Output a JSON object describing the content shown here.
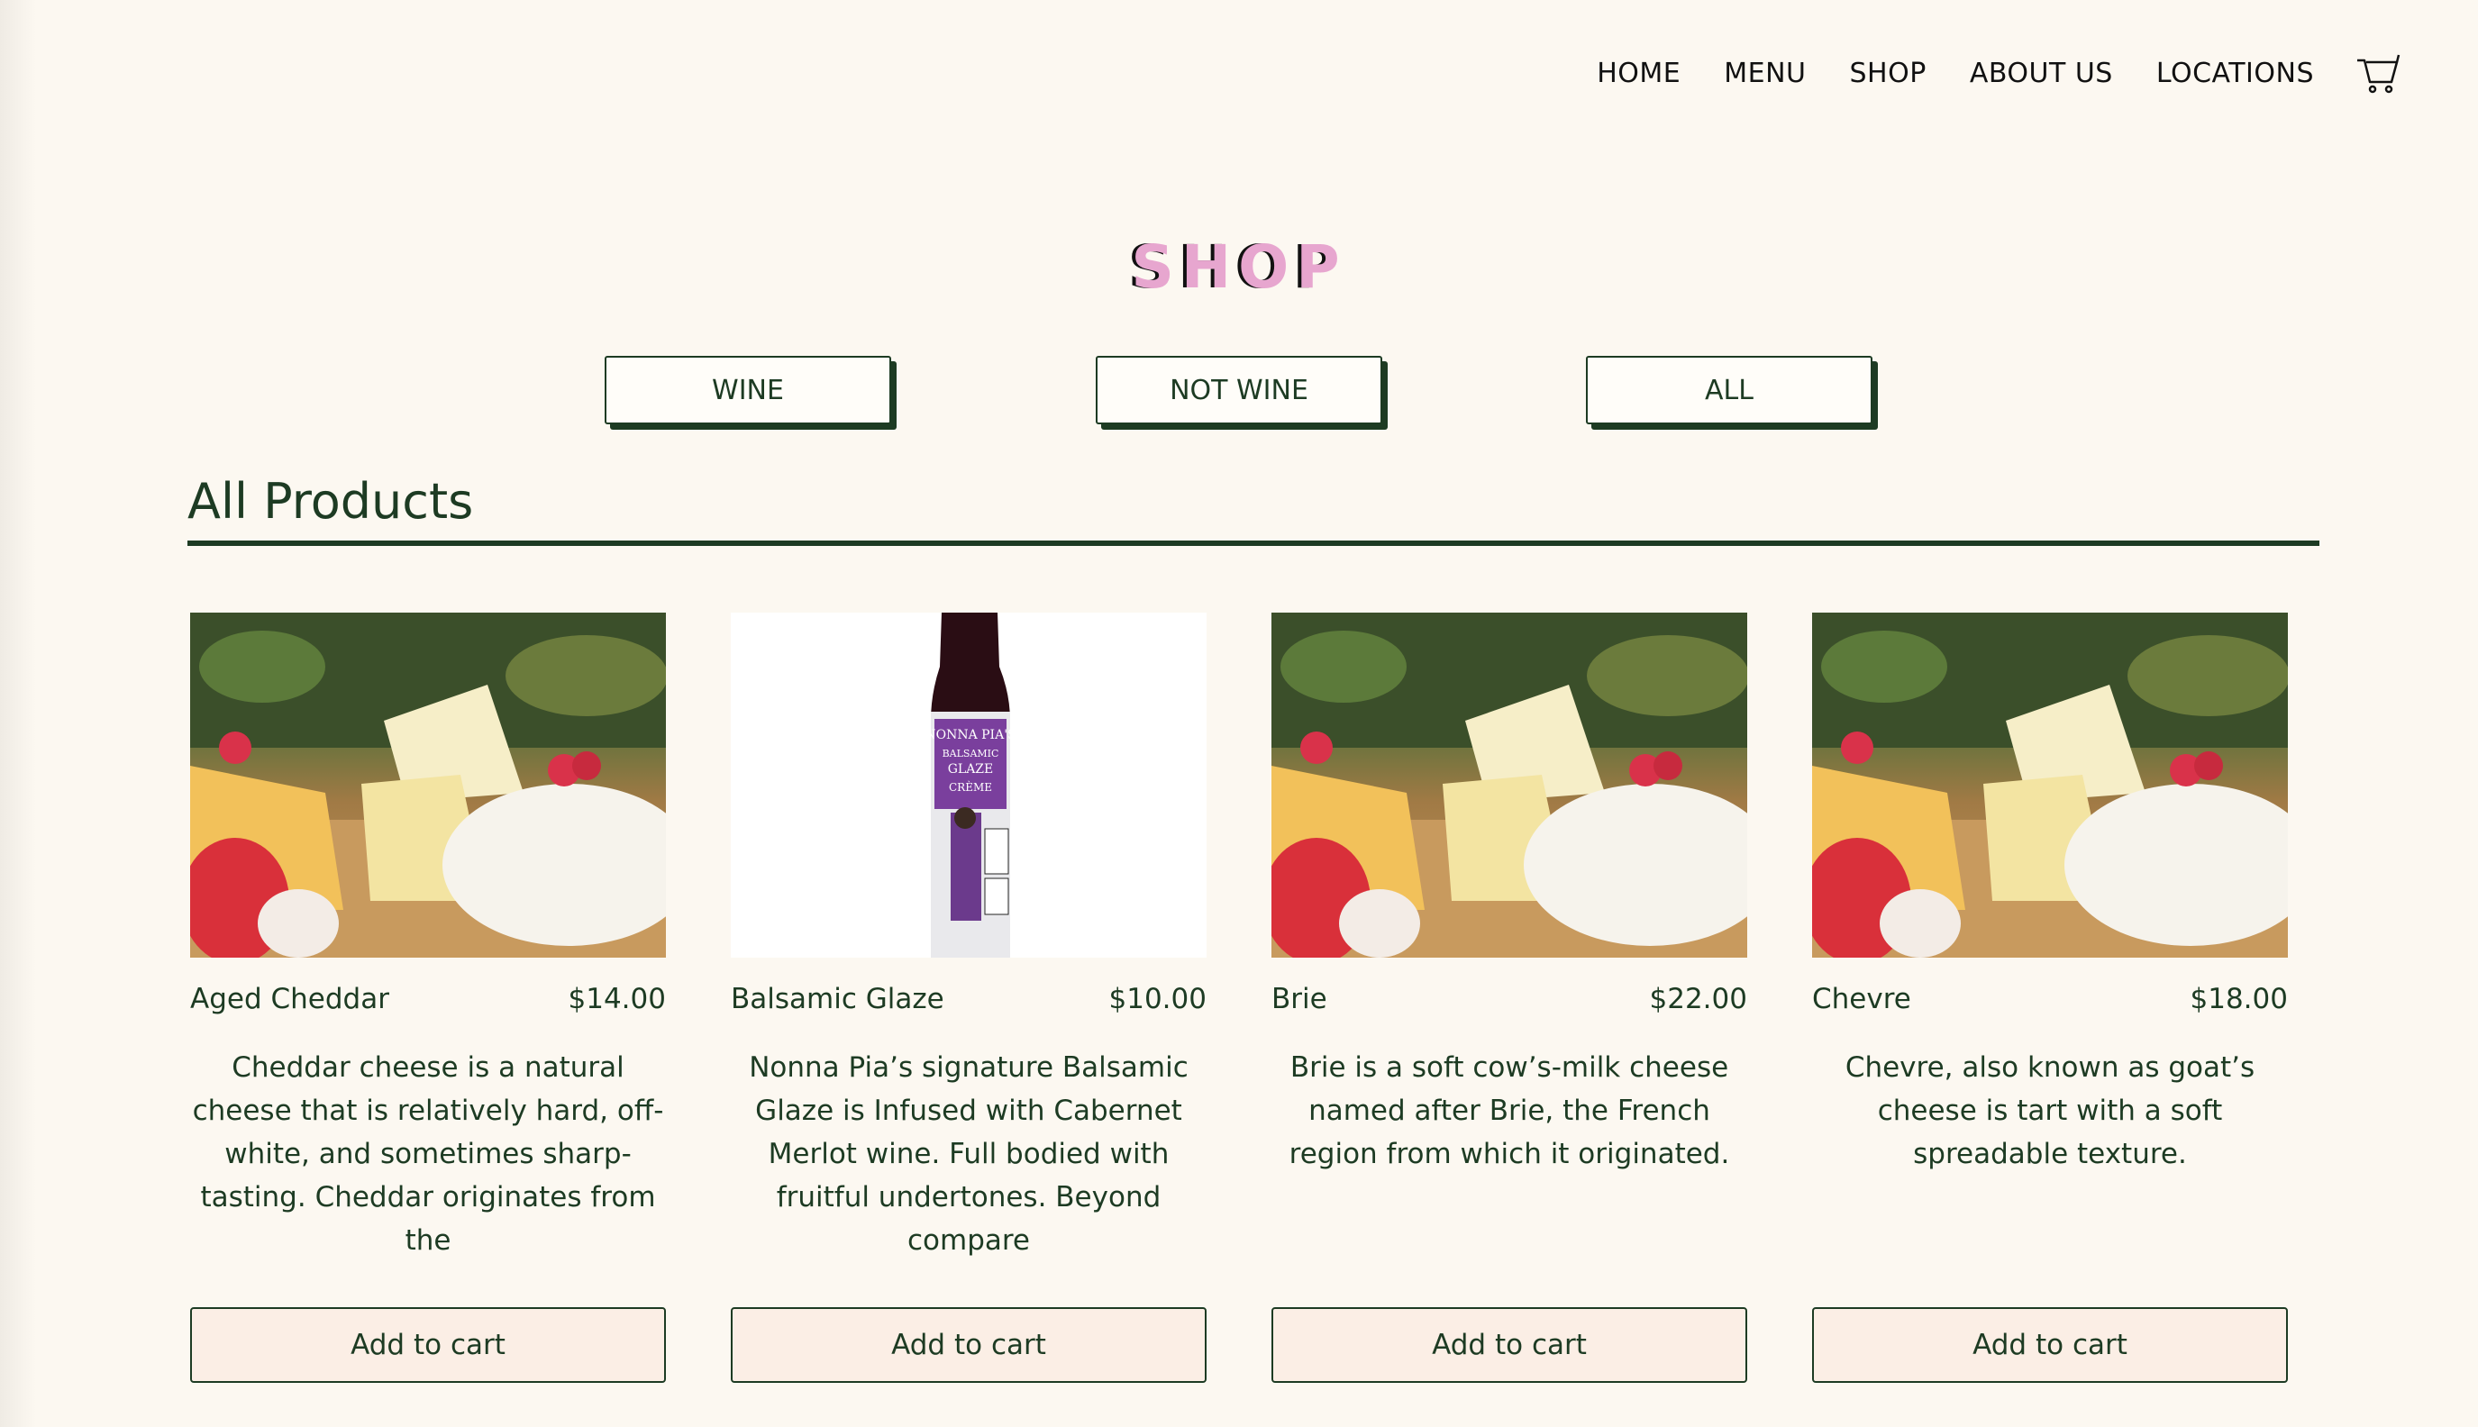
{
  "nav": {
    "items": [
      "HOME",
      "MENU",
      "SHOP",
      "ABOUT US",
      "LOCATIONS"
    ],
    "cart_icon": "shopping-cart-icon"
  },
  "page": {
    "title": "SHOP"
  },
  "filters": [
    "WINE",
    "NOT WINE",
    "ALL"
  ],
  "section": {
    "title": "All Products"
  },
  "products": [
    {
      "name": "Aged Cheddar",
      "price": "$14.00",
      "description": "Cheddar cheese is a natural cheese that is relatively hard, off-white, and sometimes sharp-tasting. Cheddar originates from the",
      "image": "cheese-board-photo",
      "button": "Add to cart"
    },
    {
      "name": "Balsamic Glaze",
      "price": "$10.00",
      "description": "Nonna Pia’s signature Balsamic Glaze is Infused with Cabernet Merlot wine. Full bodied with fruitful undertones. Beyond compare",
      "image": "balsamic-bottle-photo",
      "bottle_label": "NONNA PIA'S BALSAMIC GLAZE CRÈME DE BALSAMIQUE",
      "button": "Add to cart"
    },
    {
      "name": "Brie",
      "price": "$22.00",
      "description": "Brie is a soft cow’s-milk cheese named after Brie, the French region from which it originated.",
      "image": "cheese-board-photo",
      "button": "Add to cart"
    },
    {
      "name": "Chevre",
      "price": "$18.00",
      "description": "Chevre, also known as goat’s cheese is tart with a soft spreadable texture.",
      "image": "cheese-board-photo",
      "button": "Add to cart"
    }
  ],
  "colors": {
    "background": "#fcf8f1",
    "accent_green": "#1d3b23",
    "title_pink": "#e7a6cf",
    "button_fill": "#fbeee5"
  }
}
